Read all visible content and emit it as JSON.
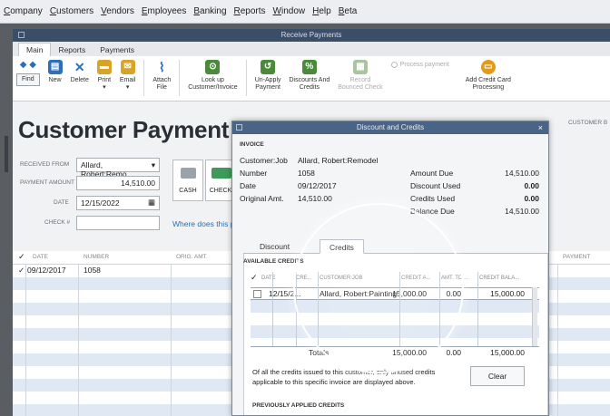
{
  "menubar": [
    "Company",
    "Customers",
    "Vendors",
    "Employees",
    "Banking",
    "Reports",
    "Window",
    "Help",
    "Beta"
  ],
  "window": {
    "title": "Receive Payments"
  },
  "ribbon_tabs": [
    "Main",
    "Reports",
    "Payments"
  ],
  "ribbon": {
    "find": "Find",
    "new": "New",
    "delete": "Delete",
    "print": "Print",
    "email": "Email",
    "attach_line1": "Attach",
    "attach_line2": "File",
    "lookup_line1": "Look up",
    "lookup_line2": "Customer/Invoice",
    "unapply_line1": "Un-Apply",
    "unapply_line2": "Payment",
    "discounts_line1": "Discounts And",
    "discounts_line2": "Credits",
    "record_line1": "Record",
    "record_line2": "Bounced Check",
    "process_payment": "Process payment",
    "addcc_line1": "Add Credit Card",
    "addcc_line2": "Processing"
  },
  "form": {
    "title": "Customer Payment",
    "received_from_label": "RECEIVED FROM",
    "received_from_value": "Allard, Robert:Remo...",
    "payment_amount_label": "PAYMENT AMOUNT",
    "payment_amount_value": "14,510.00",
    "date_label": "DATE",
    "date_value": "12/15/2022",
    "check_label": "CHECK #",
    "cash_label": "CASH",
    "check_button_label": "CHECK",
    "where_link": "Where does this paym",
    "customer_balance_label": "CUSTOMER B"
  },
  "grid": {
    "headers": [
      "DATE",
      "NUMBER",
      "ORIG. AMT.",
      "PAYMENT"
    ],
    "rows": [
      {
        "date": "09/12/2017",
        "number": "1058"
      }
    ]
  },
  "dialog": {
    "title": "Discount and Credits",
    "invoice_section": "INVOICE",
    "customer_job_label": "Customer:Job",
    "customer_job_value": "Allard, Robert:Remodel",
    "number_label": "Number",
    "number_value": "1058",
    "date_label": "Date",
    "date_value": "09/12/2017",
    "orig_amt_label": "Original Amt.",
    "orig_amt_value": "14,510.00",
    "amount_due_label": "Amount Due",
    "amount_due_value": "14,510.00",
    "discount_used_label": "Discount Used",
    "discount_used_value": "0.00",
    "credits_used_label": "Credits Used",
    "credits_used_value": "0.00",
    "balance_due_label": "Balance Due",
    "balance_due_value": "14,510.00",
    "tabs": [
      "Discount",
      "Credits"
    ],
    "available_credits": "AVAILABLE CREDITS",
    "credit_headers": [
      "DATE",
      "CRE...",
      "CUSTOMER:JOB",
      "CREDIT A...",
      "AMT. TO ...",
      "CREDIT BALA..."
    ],
    "credit_rows": [
      {
        "date": "12/15/2...",
        "customer_job": "Allard, Robert:Painting",
        "credit_amt": "15,000.00",
        "amt_to_use": "0.00",
        "credit_balance": "15,000.00"
      }
    ],
    "totals_label": "Totals",
    "totals_credit_amt": "15,000.00",
    "totals_amt_to_use": "0.00",
    "totals_credit_balance": "15,000.00",
    "note_line1": "Of all the credits issued to this customer, only unused credits",
    "note_line2": "applicable to this specific invoice are displayed above.",
    "clear_button": "Clear",
    "previously_applied": "PREVIOUSLY APPLIED CREDITS"
  },
  "colors": {
    "titlebar": "#3b4e68",
    "dialog_titlebar": "#4a6486",
    "row_alt": "#dfe8f3"
  }
}
